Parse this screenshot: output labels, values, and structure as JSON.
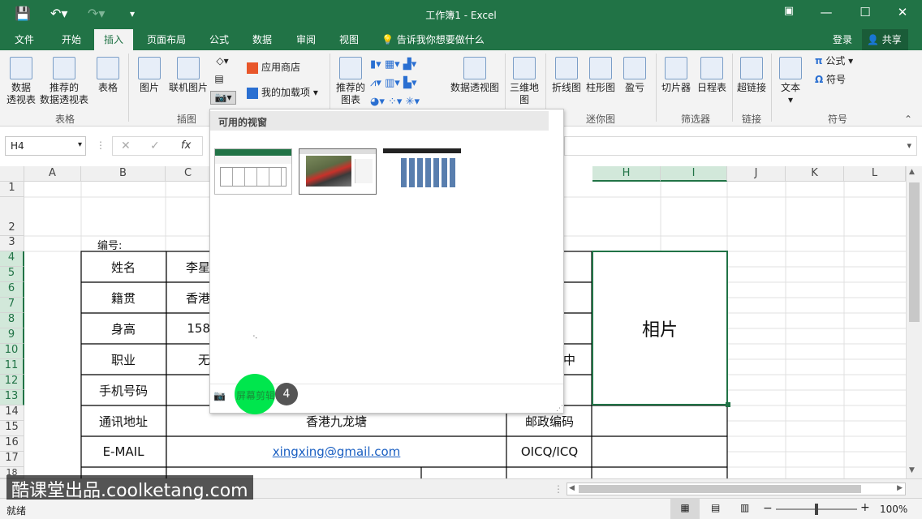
{
  "window": {
    "title": "工作簿1 - Excel"
  },
  "tabs": [
    "文件",
    "开始",
    "插入",
    "页面布局",
    "公式",
    "数据",
    "审阅",
    "视图"
  ],
  "tell_me": "告诉我你想要做什么",
  "account": {
    "login": "登录",
    "share": "共享"
  },
  "ribbon": {
    "pivot": "数据\n透视表",
    "recommended_pivot": "推荐的\n数据透视表",
    "table": "表格",
    "group_tables": "表格",
    "picture": "图片",
    "online_picture": "联机图片",
    "group_illustrations": "插图",
    "app_store": "应用商店",
    "my_addins": "我的加载项",
    "recommended_charts": "推荐的\n图表",
    "pivot_chart": "数据透视图",
    "map3d": "三维地\n图",
    "line": "折线图",
    "column": "柱形图",
    "winloss": "盈亏",
    "group_sparklines": "迷你图",
    "slicer": "切片器",
    "timeline": "日程表",
    "group_filters": "筛选器",
    "hyperlink": "超链接",
    "group_links": "链接",
    "text": "文本",
    "equation": "公式",
    "symbol": "符号",
    "group_symbols": "符号"
  },
  "formula_bar": {
    "name_box": "H4"
  },
  "columns": [
    "A",
    "B",
    "C",
    "H",
    "I",
    "J",
    "K",
    "L"
  ],
  "rows": [
    "1",
    "2",
    "3",
    "4",
    "5",
    "6",
    "7",
    "8",
    "9",
    "10",
    "11",
    "12",
    "13",
    "14",
    "15",
    "16",
    "17",
    "18"
  ],
  "sheet": {
    "label_no": "编号:",
    "name": "姓名",
    "name_val": "李星",
    "origin": "籍贯",
    "origin_val": "香港",
    "height": "身高",
    "height_val": "158",
    "job": "职业",
    "job_val": "无",
    "job_right": "中",
    "phone": "手机号码",
    "address": "通讯地址",
    "address_val": "香港九龙塘",
    "postcode": "邮政编码",
    "email": "E-MAIL",
    "email_val": "xingxing@gmail.com",
    "oicq": "OICQ/ICQ",
    "photo": "相片"
  },
  "screenshot_panel": {
    "header": "可用的视窗",
    "clip_label": "屏幕剪辑(C)",
    "step_badge": "4"
  },
  "status": {
    "ready": "就绪",
    "zoom": "100%"
  },
  "watermark": "酷课堂出品.coolketang.com",
  "colors": {
    "excel_green": "#217346",
    "highlight_green": "#00e64d"
  }
}
